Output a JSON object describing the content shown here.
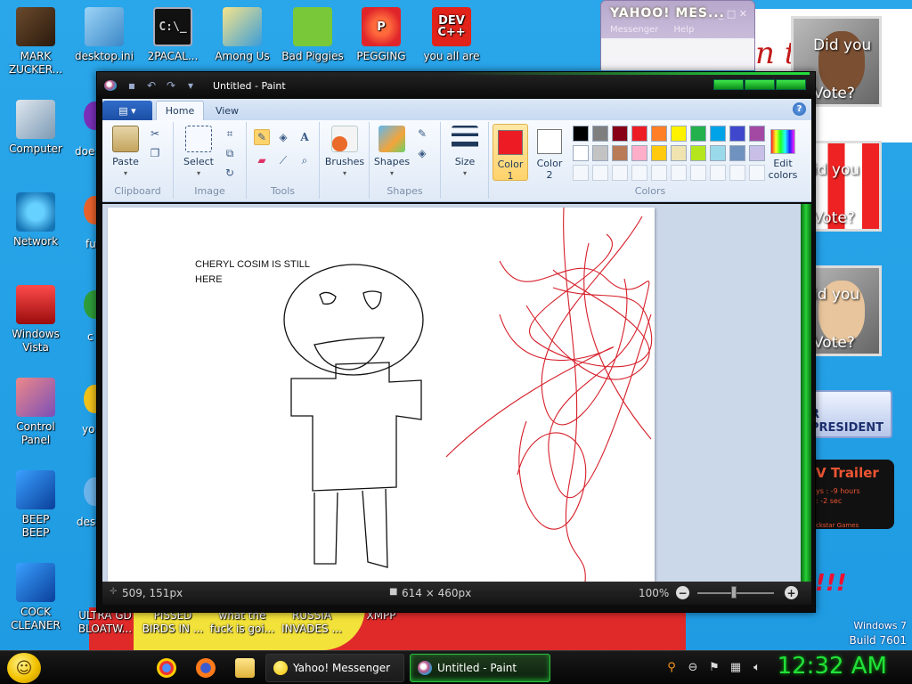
{
  "desktop": {
    "top_icons": [
      {
        "label": "MARK\nZUCKER..."
      },
      {
        "label": "desktop.ini"
      },
      {
        "label": "2PACAL..."
      },
      {
        "label": "Among Us"
      },
      {
        "label": "Bad Piggies"
      },
      {
        "label": "PEGGING"
      },
      {
        "label": "you all are"
      }
    ],
    "left_icons": [
      {
        "label": "Computer"
      },
      {
        "label": "Network"
      },
      {
        "label": "Windows\nVista"
      },
      {
        "label": "Control\nPanel"
      },
      {
        "label": "BEEP\nBEEP"
      },
      {
        "label": "COCK\nCLEANER"
      }
    ],
    "partial_labels": [
      "doe",
      "fu",
      "c",
      "yo",
      "des"
    ],
    "bottom_labels": [
      {
        "label": "ULTRA GD\nBLOATW..."
      },
      {
        "label": "PISSED\nBIRDS IN ..."
      },
      {
        "label": "what the\nfuck is goi..."
      },
      {
        "label": "RUSSIA\nINVADES ..."
      },
      {
        "label": "XMPP"
      }
    ],
    "icon_glyphs": {
      "peg": "P",
      "dev": "DEV\nC++",
      "cmd": "C:\\_"
    }
  },
  "yahoo_window": {
    "title": "YAHOO! MES...",
    "menu": [
      "Messenger",
      "Help"
    ],
    "controls": "_ □ ✕"
  },
  "sidebar_ads": {
    "promo_text": "n t",
    "vote_q1": "Did you",
    "vote_q2": "Vote?",
    "vote_q1_short": "id you",
    "president_banner": "R PRESIDENT",
    "trailer_title": "V Trailer",
    "trailer_detail": "ys : -9 hours\n: -2 sec",
    "trailer_footer": "ckstar Games",
    "bangs": "!!!",
    "os_name": "Windows 7",
    "build": "Build 7601"
  },
  "paint": {
    "window_title": "Untitled - Paint",
    "tabs": [
      "Home",
      "View"
    ],
    "help_glyph": "?",
    "groups": {
      "clipboard": {
        "label": "Clipboard",
        "paste": "Paste"
      },
      "image": {
        "label": "Image",
        "select": "Select"
      },
      "tools": {
        "label": "Tools"
      },
      "brushes": {
        "label": "Brushes"
      },
      "shapes": {
        "label": "Shapes",
        "button": "Shapes"
      },
      "size": {
        "label": "Size"
      },
      "colors": {
        "label": "Colors",
        "color1": "Color\n1",
        "color2": "Color\n2",
        "edit": "Edit\ncolors"
      }
    },
    "palette_row1": [
      "#000000",
      "#7f7f7f",
      "#880015",
      "#ed1c24",
      "#ff7f27",
      "#fff200",
      "#22b14c",
      "#00a2e8",
      "#3f48cc",
      "#a349a4"
    ],
    "palette_row2": [
      "#ffffff",
      "#c3c3c3",
      "#b97a57",
      "#ffaec9",
      "#ffc90e",
      "#efe4b0",
      "#b5e61d",
      "#99d9ea",
      "#7092be",
      "#c8bfe7"
    ],
    "color1_value": "#ed1c24",
    "color2_value": "#ffffff",
    "canvas_text": "CHERYL COSIM IS STILL HERE",
    "status": {
      "cursor_pos": "509, 151px",
      "canvas_size": "614 × 460px",
      "zoom": "100%"
    }
  },
  "taskbar": {
    "tasks": [
      {
        "label": "Yahoo! Messenger"
      },
      {
        "label": "Untitled - Paint"
      }
    ],
    "clock": "12:32 AM"
  }
}
